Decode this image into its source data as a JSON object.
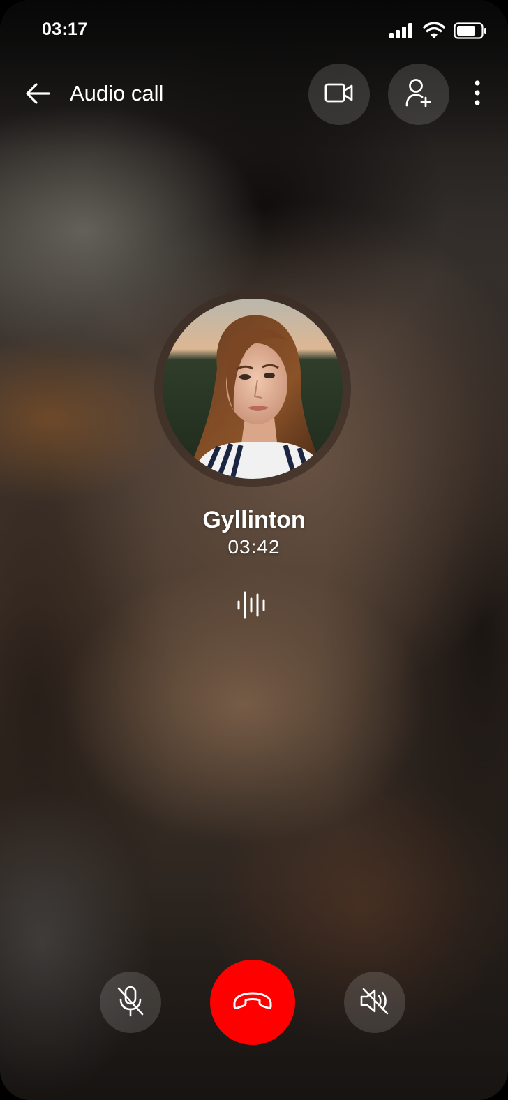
{
  "status_bar": {
    "time": "03:17",
    "icons": [
      "cellular-signal-icon",
      "wifi-icon",
      "battery-icon"
    ]
  },
  "header": {
    "title": "Audio call",
    "back_icon": "arrow-left-icon",
    "actions": [
      {
        "name": "video-call-button",
        "icon": "video-camera-icon"
      },
      {
        "name": "add-participant-button",
        "icon": "user-plus-icon"
      },
      {
        "name": "more-options-button",
        "icon": "vertical-dots-icon"
      }
    ]
  },
  "caller": {
    "name": "Gyllinton",
    "duration": "03:42",
    "avatar_icon": "caller-avatar-photo",
    "activity_icon": "audio-waveform-icon"
  },
  "controls": [
    {
      "name": "mute-microphone-button",
      "icon": "microphone-off-icon"
    },
    {
      "name": "end-call-button",
      "icon": "phone-hangup-icon",
      "color": "#FF0000"
    },
    {
      "name": "speaker-off-button",
      "icon": "speaker-muted-icon"
    }
  ],
  "colors": {
    "end_call": "#FF0000",
    "text": "#FFFFFF",
    "button_bg": "rgba(255,255,255,0.14)"
  }
}
